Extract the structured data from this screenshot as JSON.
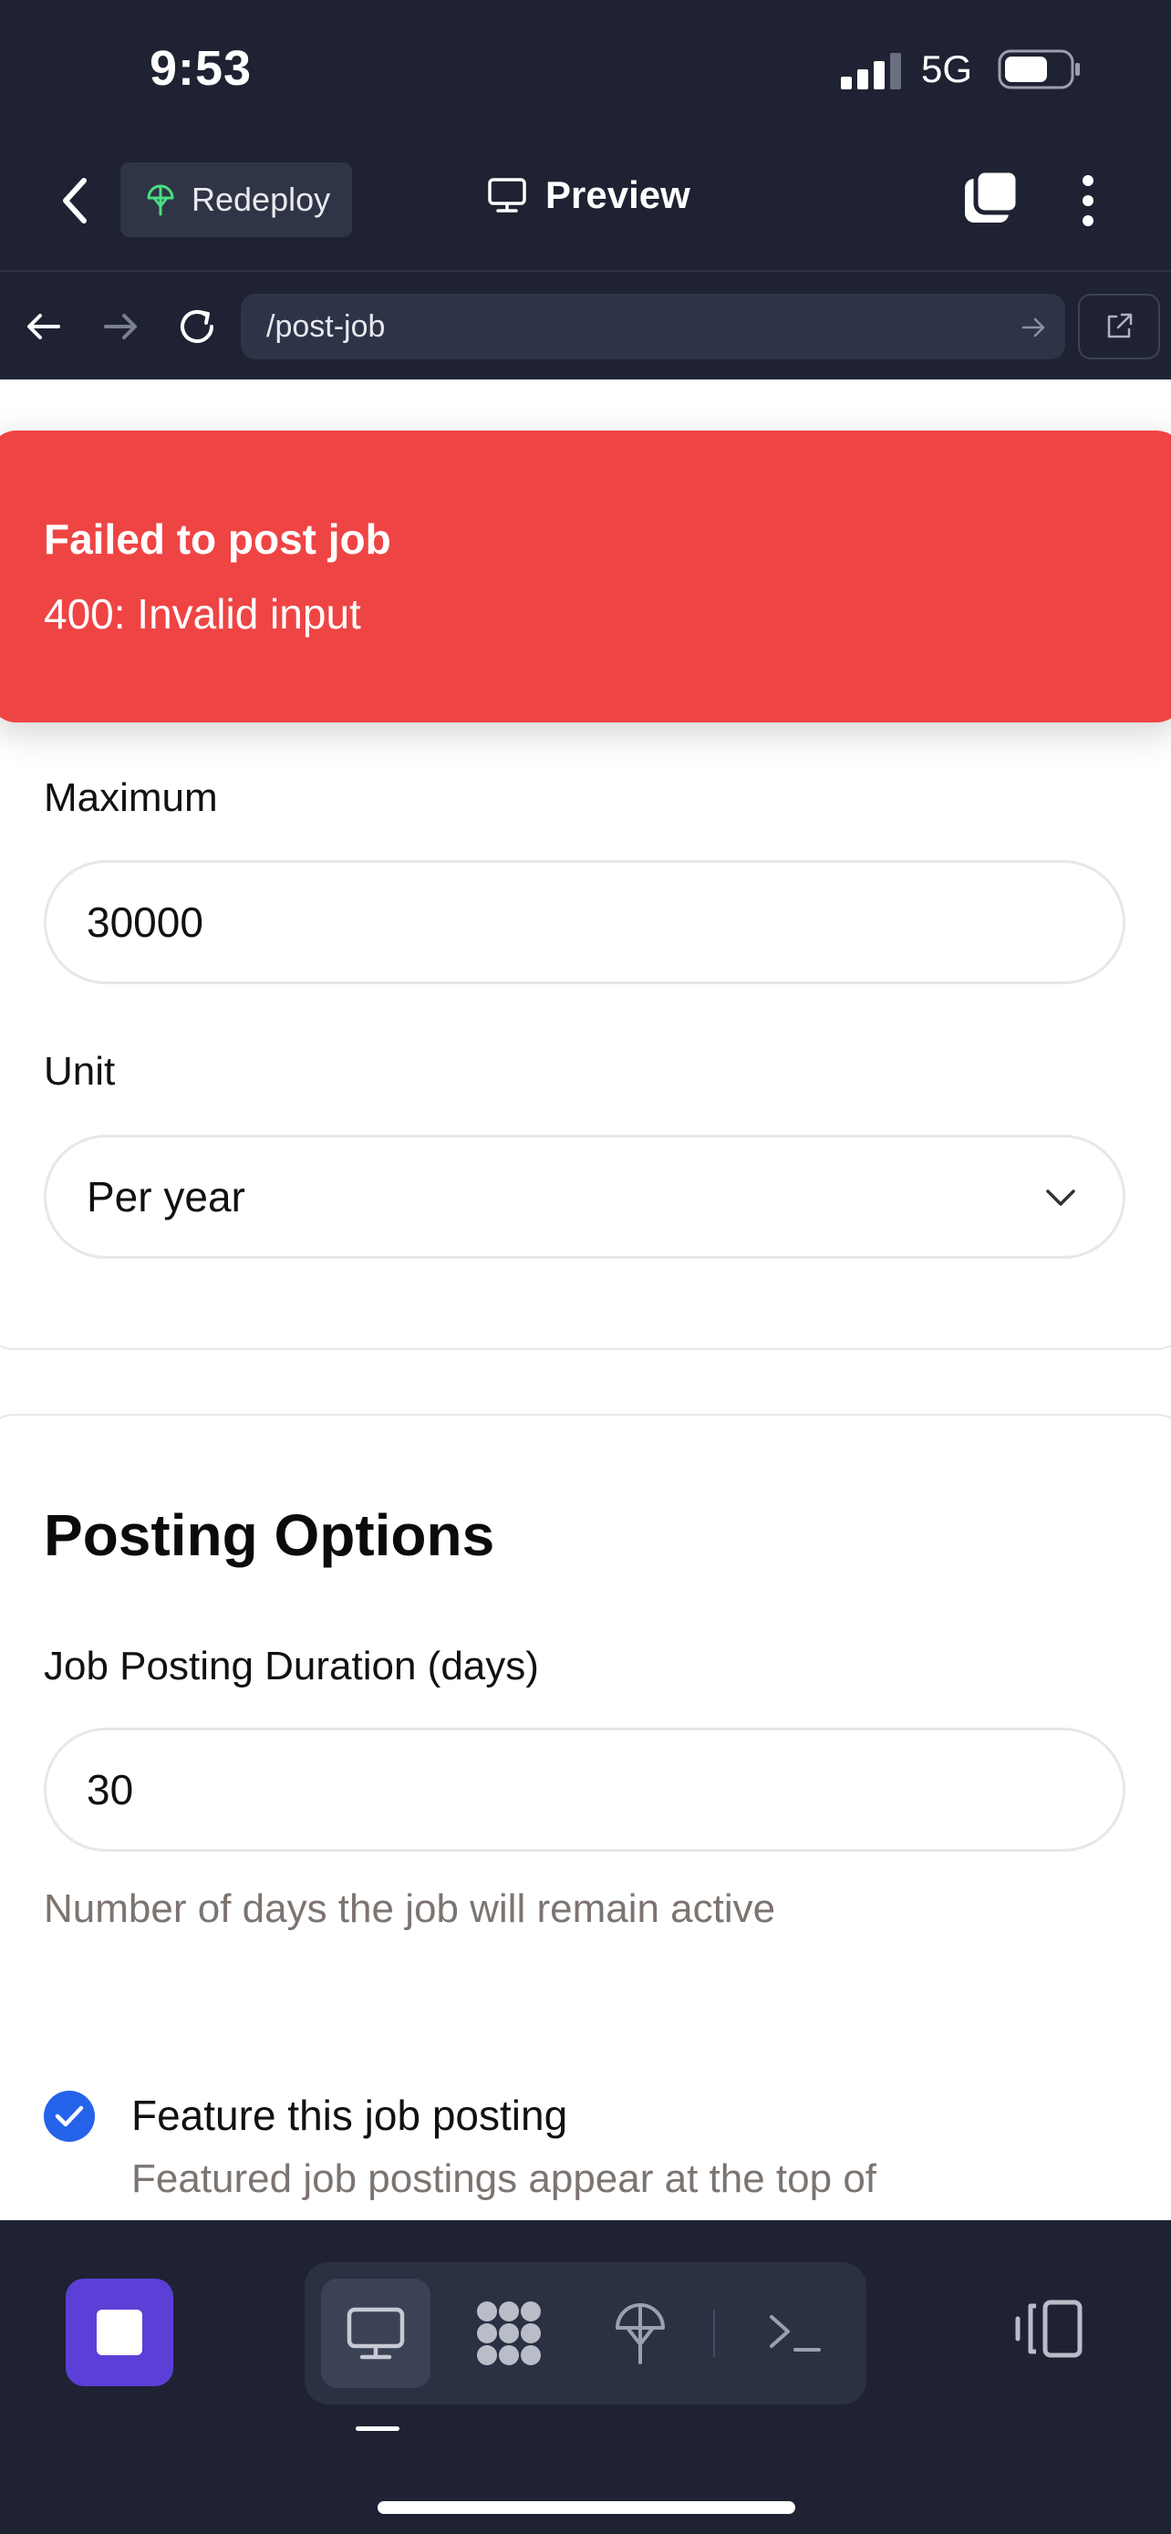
{
  "status_bar": {
    "time": "9:53",
    "network": "5G"
  },
  "header": {
    "redeploy_label": "Redeploy",
    "preview_label": "Preview"
  },
  "browser": {
    "url": "/post-job"
  },
  "toast": {
    "title": "Failed to post job",
    "message": "400: Invalid input"
  },
  "salary": {
    "maximum_label": "Maximum",
    "maximum_value": "30000",
    "unit_label": "Unit",
    "unit_value": "Per year"
  },
  "posting_options": {
    "title": "Posting Options",
    "duration_label": "Job Posting Duration (days)",
    "duration_value": "30",
    "duration_help": "Number of days the job will remain active",
    "feature_label": "Feature this job posting",
    "feature_checked": true,
    "feature_desc": "Featured job postings appear at the top of"
  },
  "colors": {
    "app_bg": "#1e2232",
    "toast_bg": "#ef4444",
    "accent_purple": "#5b3fd6",
    "checkbox_blue": "#2563eb",
    "redeploy_icon": "#4ade80"
  },
  "icons": {
    "status": [
      "signal-icon",
      "battery-icon"
    ],
    "header": [
      "back-chevron-icon",
      "redeploy-icon",
      "monitor-icon",
      "tabs-icon",
      "more-vertical-icon"
    ],
    "browser": [
      "back-arrow-icon",
      "forward-arrow-icon",
      "reload-icon",
      "url-go-icon",
      "external-link-icon"
    ],
    "bottom": [
      "stop-icon",
      "monitor-icon",
      "apps-icon",
      "deploy-icon",
      "terminal-icon",
      "layout-icon"
    ]
  }
}
